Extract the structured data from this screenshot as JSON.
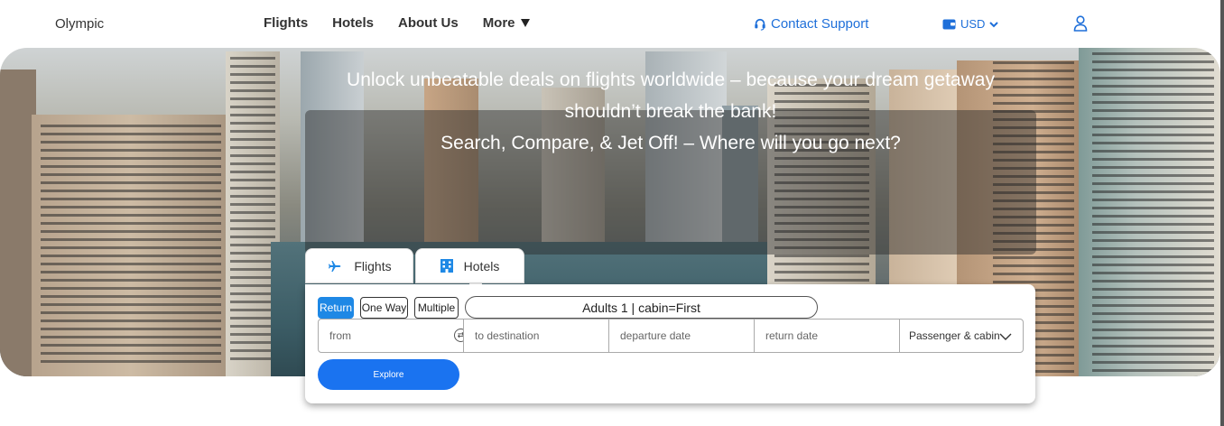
{
  "navbar": {
    "brand": "Olympic",
    "links": [
      "Flights",
      "Hotels",
      "About Us",
      "More"
    ],
    "support": "Contact Support",
    "currency": "USD"
  },
  "hero": {
    "line1": "Unlock unbeatable deals on flights worldwide – because your dream getaway",
    "line2": "shouldn’t break the bank!",
    "line3": "Search, Compare, & Jet Off! – Where will you go next?"
  },
  "tabs": {
    "flights": "Flights",
    "hotels": "Hotels"
  },
  "search": {
    "trip_types": [
      "Return",
      "One Way",
      "Multiple"
    ],
    "active_trip": "Return",
    "summary": "Adults 1 | cabin=First",
    "from_placeholder": "from",
    "to_placeholder": "to destination",
    "departure_placeholder": "departure date",
    "return_placeholder": "return date",
    "pax_label": "Passenger & cabin",
    "explore_label": "Explore"
  },
  "colors": {
    "accent": "#1e6fd9",
    "button": "#1a73f0"
  },
  "icons": [
    "headset-icon",
    "wallet-icon",
    "chevron-down-icon",
    "user-icon",
    "plane-icon",
    "hotel-icon",
    "swap-icon"
  ]
}
